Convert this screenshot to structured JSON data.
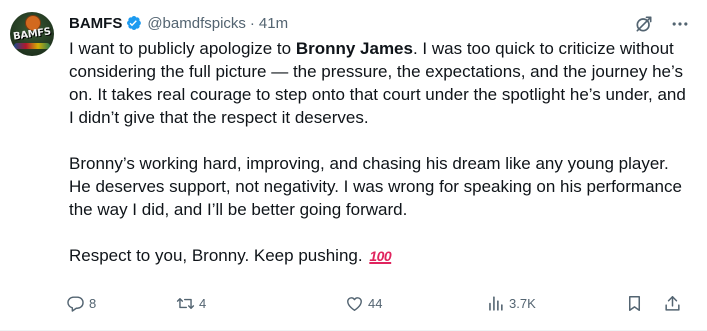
{
  "tweet": {
    "display_name": "BAMFS",
    "avatar_text": "BAMFS",
    "handle": "@bamdfspicks",
    "separator": "·",
    "time": "41m",
    "paragraphs": {
      "p1_pre": "I want to publicly apologize to ",
      "p1_mention": "Bronny James",
      "p1_post": ". I was too quick to criticize without considering the full picture — the pressure, the expectations, and the journey he’s on. It takes real courage to step onto that court under the spotlight he’s under, and I didn’t give that the respect it deserves.",
      "p2": "Bronny’s working hard, improving, and chasing his dream like any young player. He deserves support, not negativity. I was wrong for speaking on his performance the way I did, and I’ll be better going forward.",
      "p3": "Respect to you, Bronny. Keep pushing. ",
      "p3_emoji": "100"
    },
    "actions": {
      "replies": "8",
      "reposts": "4",
      "likes": "44",
      "views": "3.7K"
    },
    "icons": [
      "verified-badge-icon",
      "grok-icon",
      "more-icon",
      "reply-icon",
      "repost-icon",
      "like-icon",
      "views-icon",
      "bookmark-icon",
      "share-icon"
    ],
    "colors": {
      "text": "#0f1419",
      "secondary": "#536471",
      "verified": "#1d9bf0",
      "emoji": "#e0245e"
    }
  }
}
